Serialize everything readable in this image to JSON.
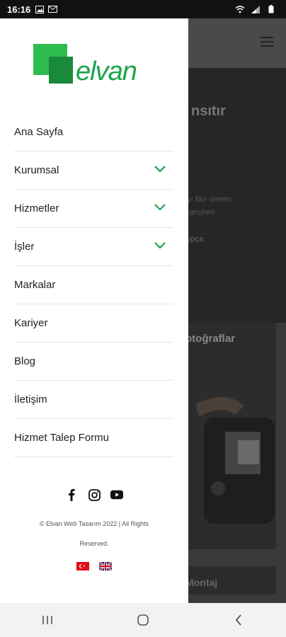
{
  "status_bar": {
    "time": "16:16",
    "left_icons": [
      "image-icon",
      "mail-icon"
    ],
    "right_icons": [
      "wifi-icon",
      "signal-icon",
      "battery-icon"
    ]
  },
  "drawer": {
    "logo_text": "elvan",
    "brand_color": "#1aa44a",
    "menu": [
      {
        "label": "Ana Sayfa",
        "has_submenu": false
      },
      {
        "label": "Kurumsal",
        "has_submenu": true
      },
      {
        "label": "Hizmetler",
        "has_submenu": true
      },
      {
        "label": "İşler",
        "has_submenu": true
      },
      {
        "label": "Markalar",
        "has_submenu": false
      },
      {
        "label": "Kariyer",
        "has_submenu": false
      },
      {
        "label": "Blog",
        "has_submenu": false
      },
      {
        "label": "İletişim",
        "has_submenu": false
      },
      {
        "label": "Hizmet Talep Formu",
        "has_submenu": false
      }
    ],
    "social": [
      "facebook-icon",
      "instagram-icon",
      "youtube-icon"
    ],
    "copyright_line1": "© Elvan Web Tasarım 2022 | All Rights",
    "copyright_line2": "Reserved.",
    "languages": [
      "tr-flag",
      "uk-flag"
    ]
  },
  "background_page": {
    "hero_title": "nsıtır",
    "hero_sub1": "ayı fikir üreten",
    "hero_sub2": "a geçiren",
    "hero_link": "aypça",
    "card_title": "otoğraflar",
    "card2_title": "Montaj"
  },
  "nav_bar": {
    "buttons": [
      "recents-icon",
      "home-icon",
      "back-icon"
    ]
  }
}
